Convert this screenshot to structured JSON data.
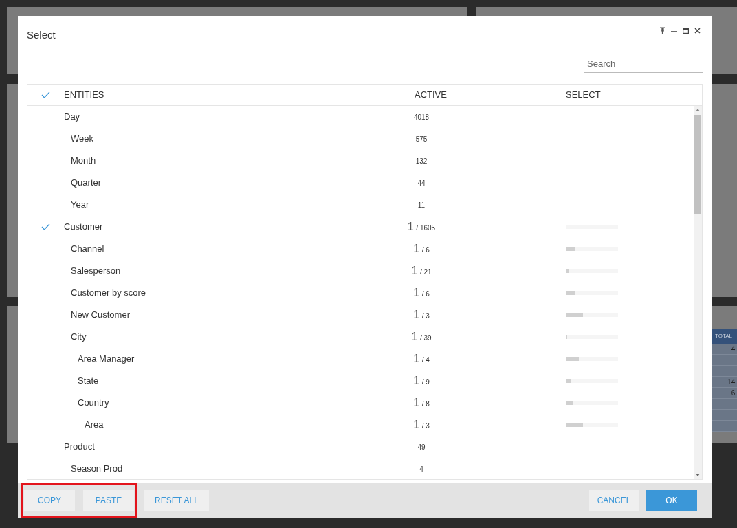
{
  "background_table": {
    "header": "TOTAL",
    "cells": [
      "4.",
      "",
      "",
      "14.",
      "6.",
      "",
      "",
      ""
    ]
  },
  "dialog": {
    "title": "Select",
    "search": {
      "placeholder": "Search"
    },
    "columns": {
      "check": {
        "checked": true
      },
      "entities": "ENTITIES",
      "active": "ACTIVE",
      "select": "SELECT"
    },
    "rows": [
      {
        "name": "Day",
        "checked": false,
        "active": {
          "count": "4018"
        },
        "children": [
          {
            "name": "Week",
            "checked": false,
            "active": {
              "count": "575"
            }
          },
          {
            "name": "Month",
            "checked": false,
            "active": {
              "count": "132"
            }
          },
          {
            "name": "Quarter",
            "checked": false,
            "active": {
              "count": "44"
            }
          },
          {
            "name": "Year",
            "checked": false,
            "active": {
              "count": "11"
            }
          }
        ]
      },
      {
        "name": "Customer",
        "checked": true,
        "active": {
          "selected": "1",
          "total": "/ 1605"
        },
        "level": 0.0,
        "children": [
          {
            "name": "Channel",
            "checked": false,
            "active": {
              "selected": "1",
              "total": "/ 6"
            },
            "level": 0.17
          },
          {
            "name": "Salesperson",
            "checked": false,
            "active": {
              "selected": "1",
              "total": "/ 21"
            },
            "level": 0.05
          },
          {
            "name": "Customer by score",
            "checked": false,
            "active": {
              "selected": "1",
              "total": "/ 6"
            },
            "level": 0.17
          },
          {
            "name": "New Customer",
            "checked": false,
            "active": {
              "selected": "1",
              "total": "/ 3"
            },
            "level": 0.33
          },
          {
            "name": "City",
            "checked": false,
            "active": {
              "selected": "1",
              "total": "/ 39"
            },
            "level": 0.03,
            "children": [
              {
                "name": "Area Manager",
                "checked": false,
                "active": {
                  "selected": "1",
                  "total": "/ 4"
                },
                "level": 0.25
              },
              {
                "name": "State",
                "checked": false,
                "active": {
                  "selected": "1",
                  "total": "/ 9"
                },
                "level": 0.11
              },
              {
                "name": "Country",
                "checked": false,
                "active": {
                  "selected": "1",
                  "total": "/ 8"
                },
                "level": 0.13,
                "children": [
                  {
                    "name": "Area",
                    "checked": false,
                    "active": {
                      "selected": "1",
                      "total": "/ 3"
                    },
                    "level": 0.33
                  }
                ]
              }
            ]
          }
        ]
      },
      {
        "name": "Product",
        "checked": false,
        "active": {
          "count": "49"
        },
        "children": [
          {
            "name": "Season Prod",
            "checked": false,
            "active": {
              "count": "4"
            }
          }
        ]
      }
    ],
    "footer": {
      "left_buttons": [
        {
          "label": "COPY",
          "highlighted": true
        },
        {
          "label": "PASTE",
          "highlighted": true
        },
        {
          "label": "RESET ALL",
          "highlighted": false
        }
      ],
      "right_buttons": [
        {
          "label": "CANCEL",
          "kind": "secondary"
        },
        {
          "label": "OK",
          "kind": "primary"
        }
      ]
    }
  }
}
